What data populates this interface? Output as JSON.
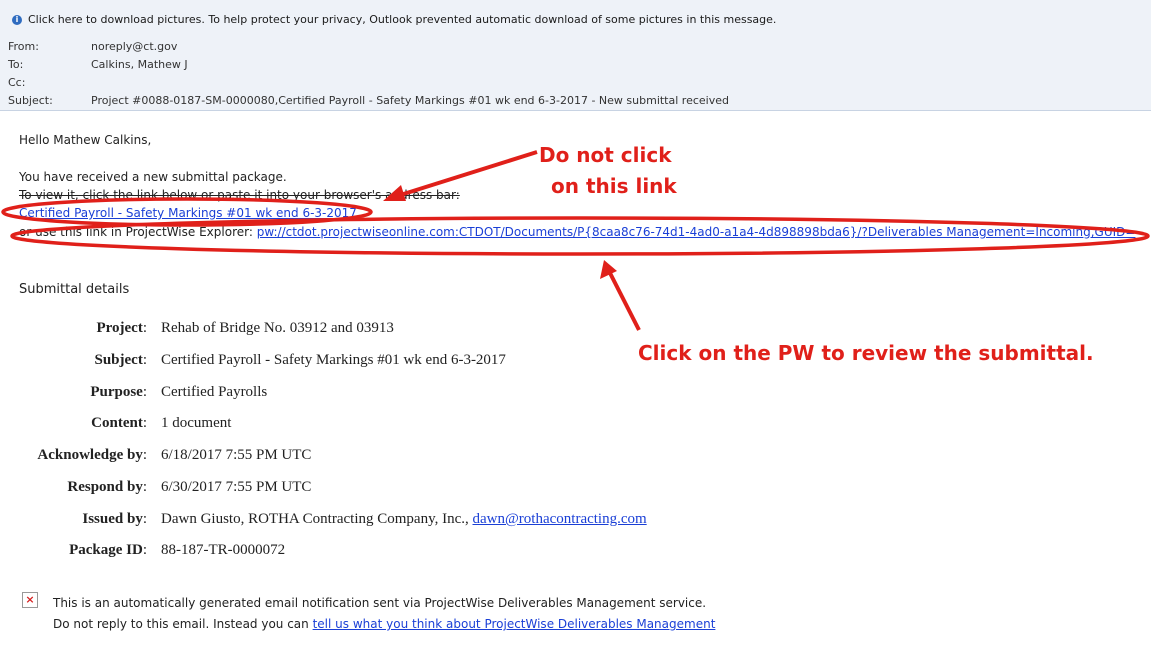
{
  "header": {
    "infobar_text": "Click here to download pictures. To help protect your privacy, Outlook prevented automatic download of some pictures in this message.",
    "info_icon": "info-icon",
    "from_label": "From:",
    "from_value": "noreply@ct.gov",
    "to_label": "To:",
    "to_value": "Calkins, Mathew J",
    "cc_label": "Cc:",
    "cc_value": "",
    "subject_label": "Subject:",
    "subject_value": "Project #0088-0187-SM-0000080,Certified Payroll - Safety Markings #01 wk end 6-3-2017 - New submittal received"
  },
  "body": {
    "greeting": "Hello Mathew Calkins,",
    "line1": "You have received a new submittal package.",
    "line2": "To view it, click the link below or paste it into your browser's address bar:",
    "web_link": "Certified Payroll - Safety Markings #01 wk end 6-3-2017",
    "pw_prefix": "or use this link in ProjectWise Explorer: ",
    "pw_link": "pw://ctdot.projectwiseonline.com:CTDOT/Documents/P{8caa8c76-74d1-4ad0-a1a4-4d898898bda6}/?Deliverables Management=Incoming,GUID=",
    "details_heading": "Submittal details"
  },
  "details": [
    {
      "label": "Project",
      "value": "Rehab of Bridge No. 03912 and 03913"
    },
    {
      "label": "Subject",
      "value": "Certified Payroll - Safety Markings #01 wk end 6-3-2017"
    },
    {
      "label": "Purpose",
      "value": "Certified Payrolls"
    },
    {
      "label": "Content",
      "value": "1 document"
    },
    {
      "label": "Acknowledge by",
      "value": "6/18/2017 7:55 PM UTC"
    },
    {
      "label": "Respond by",
      "value": "6/30/2017 7:55 PM UTC"
    },
    {
      "label": "Issued by",
      "value": "Dawn Giusto, ROTHA Contracting Company, Inc., ",
      "email": "dawn@rothacontracting.com"
    },
    {
      "label": "Package ID",
      "value": "88-187-TR-0000072"
    }
  ],
  "footer": {
    "line1": "This is an automatically generated email notification sent via ProjectWise Deliverables Management service.",
    "line2_prefix": "Do not reply to this email. Instead you can ",
    "line2_link": "tell us what you think about ProjectWise Deliverables Management",
    "broken_image_icon": "broken-image-icon"
  },
  "annotations": {
    "do_not_click_line1": "Do not click",
    "do_not_click_line2": "on this link",
    "click_pw": "Click on the PW to review the submittal.",
    "color": "#e0201a"
  }
}
